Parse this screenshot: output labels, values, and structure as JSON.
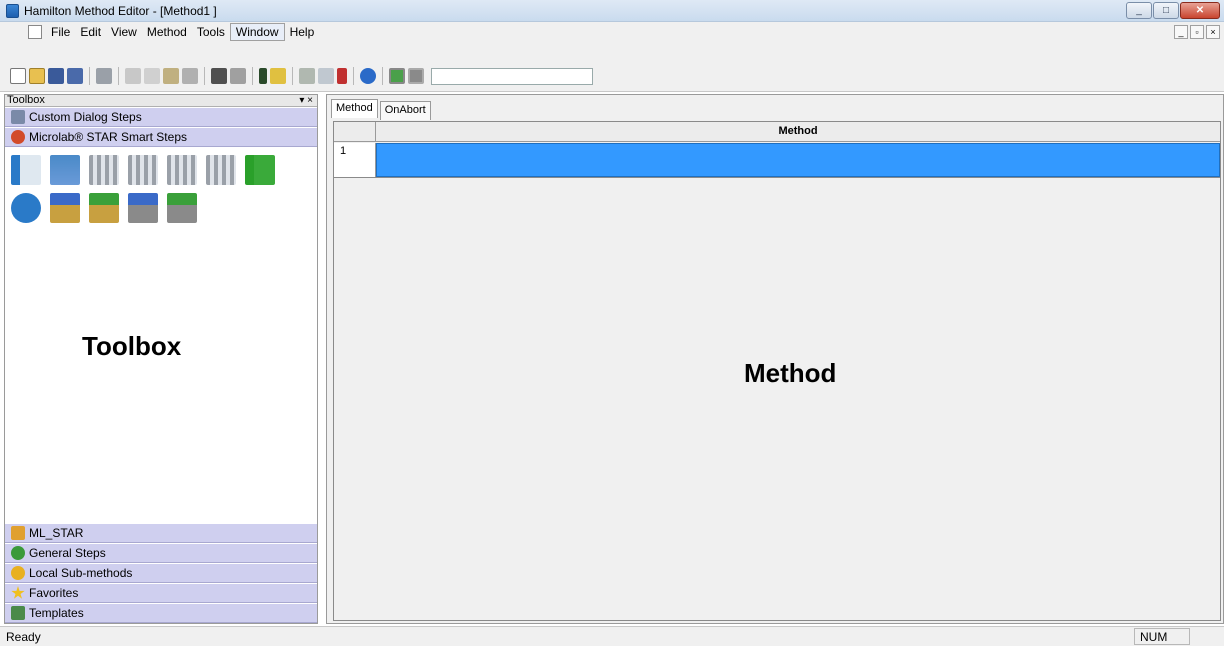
{
  "window": {
    "title": "Hamilton Method Editor - [Method1 ]",
    "controls": [
      "_",
      "□",
      "✕"
    ]
  },
  "menubar": {
    "items": [
      "File",
      "Edit",
      "View",
      "Method",
      "Tools",
      "Window",
      "Help"
    ],
    "mdi_controls": [
      "_",
      "▫",
      "×"
    ]
  },
  "toolbar": {
    "icons": [
      "new-file-icon",
      "open-folder-icon",
      "save-icon",
      "save-all-icon",
      "print-icon",
      "cut-icon",
      "copy-icon",
      "paste-icon",
      "delete-icon",
      "find-icon",
      "find-next-icon",
      "run-icon",
      "flask-icon",
      "deck-icon",
      "tip-icon",
      "pipette-icon",
      "help-icon",
      "status-green-icon",
      "status-grey-icon"
    ]
  },
  "toolbox": {
    "header": "Toolbox",
    "header_controls": "▾ ×",
    "top_categories": [
      {
        "label": "Custom Dialog Steps",
        "icon": "dialog-icon",
        "color": "#7a8aa8"
      },
      {
        "label": "Microlab® STAR Smart Steps",
        "icon": "smart-steps-icon",
        "color": "#d24b2a"
      }
    ],
    "bottom_categories": [
      {
        "label": "ML_STAR",
        "icon": "ml-star-icon",
        "color": "#e0a030"
      },
      {
        "label": "General Steps",
        "icon": "general-steps-icon",
        "color": "#3a9a3a"
      },
      {
        "label": "Local Sub-methods",
        "icon": "submethod-icon",
        "color": "#e8b020"
      },
      {
        "label": "Favorites",
        "icon": "star-icon",
        "color": "#f0c020"
      },
      {
        "label": "Templates",
        "icon": "template-icon",
        "color": "#4a8a4a"
      }
    ],
    "overlay_label": "Toolbox"
  },
  "method": {
    "tabs": [
      "Method",
      "OnAbort"
    ],
    "column_header": "Method",
    "rows": [
      "1"
    ],
    "overlay_label": "Method"
  },
  "statusbar": {
    "text": "Ready",
    "num_indicator": "NUM"
  }
}
